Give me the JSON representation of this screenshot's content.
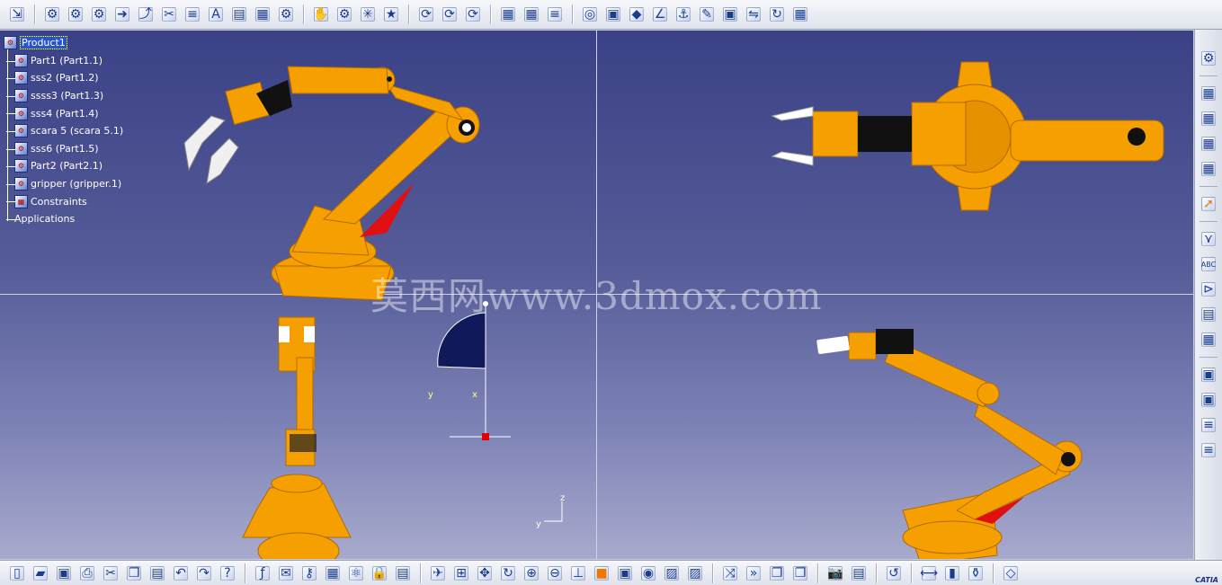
{
  "spec_tree": {
    "root": "Product1",
    "items": [
      "Part1 (Part1.1)",
      "sss2 (Part1.2)",
      "ssss3 (Part1.3)",
      "sss4 (Part1.4)",
      "scara 5 (scara 5.1)",
      "sss6 (Part1.5)",
      "Part2 (Part2.1)",
      "gripper (gripper.1)",
      "Constraints",
      "Applications"
    ]
  },
  "watermark": "莫西网www.3dmox.com",
  "compass": {
    "y_label": "y",
    "x_label": "x"
  },
  "axis_triad": {
    "z_label": "z",
    "y_label": "y"
  },
  "branding": "CATIA",
  "colors": {
    "robot": "#f5a000",
    "robot_dark": "#c87800",
    "accent_red": "#e01010",
    "gripper": "#ffffff"
  }
}
